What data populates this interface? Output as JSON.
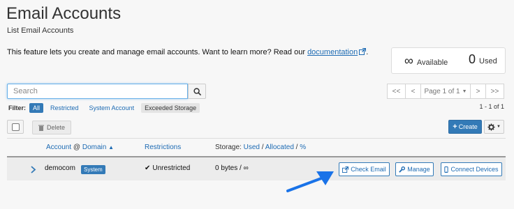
{
  "header": {
    "title": "Email Accounts",
    "subtitle": "List Email Accounts"
  },
  "intro": {
    "text": "This feature lets you create and manage email accounts. Want to learn more? Read our",
    "link_label": "documentation",
    "end": "."
  },
  "stats": {
    "available_value": "∞",
    "available_label": "Available",
    "used_value": "0",
    "used_label": "Used"
  },
  "search": {
    "placeholder": "Search",
    "value": ""
  },
  "filter": {
    "label": "Filter:",
    "options": [
      "All",
      "Restricted",
      "System Account",
      "Exceeded Storage"
    ]
  },
  "pagination": {
    "first": "<<",
    "prev": "<",
    "page_label": "Page 1 of 1",
    "next": ">",
    "last": ">>",
    "count": "1 - 1 of 1"
  },
  "toolbar": {
    "delete_label": "Delete",
    "create_label": "Create"
  },
  "table": {
    "headers": {
      "account": "Account",
      "at": "@",
      "domain": "Domain",
      "restrictions": "Restrictions",
      "storage_prefix": "Storage:",
      "used": "Used",
      "sep1": "/",
      "allocated": "Allocated",
      "sep2": "/",
      "percent": "%"
    },
    "rows": [
      {
        "account": "democom",
        "badge": "System",
        "restrictions": "Unrestricted",
        "storage": "0 bytes / ∞",
        "actions": {
          "check_email": "Check Email",
          "manage": "Manage",
          "connect_devices": "Connect Devices"
        }
      }
    ]
  },
  "colors": {
    "accent": "#337ab7",
    "link": "#1c6ab3",
    "arrow": "#1a73e8"
  }
}
